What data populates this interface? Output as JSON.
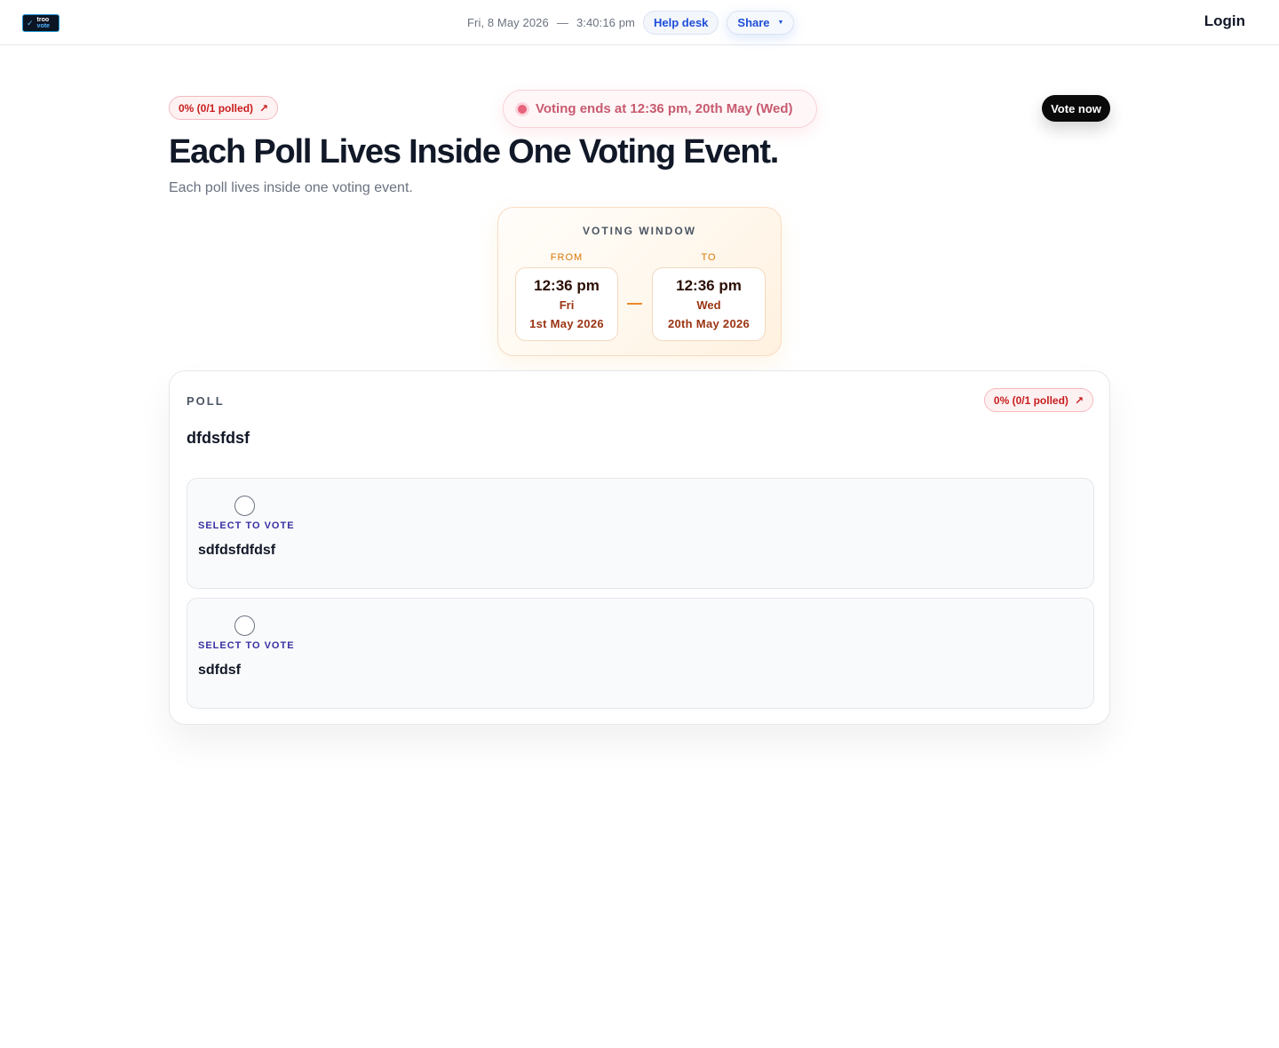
{
  "header": {
    "logo": {
      "line1": "troo",
      "line2": "vote"
    },
    "date": "Fri, 8 May 2026",
    "separator": "—",
    "time": "3:40:16 pm",
    "help_desk_label": "Help desk",
    "share_label": "Share",
    "login_label": "Login"
  },
  "event": {
    "polled_badge": "0% (0/1 polled)",
    "polled_fraction": 0,
    "ends_text": "Voting ends at 12:36 pm, 20th May (Wed)",
    "vote_now_label": "Vote now",
    "title": "Each Poll Lives Inside One Voting Event.",
    "subtitle": "Each poll lives inside one voting event."
  },
  "voting_window": {
    "title": "VOTING WINDOW",
    "from": {
      "label": "FROM",
      "time": "12:36 pm",
      "day": "Fri",
      "date": "1st May 2026"
    },
    "to": {
      "label": "TO",
      "time": "12:36 pm",
      "day": "Wed",
      "date": "20th May 2026"
    }
  },
  "poll": {
    "label": "POLL",
    "polled_badge": "0% (0/1 polled)",
    "question": "dfdsfdsf",
    "options": [
      {
        "select_label": "SELECT TO VOTE",
        "text": "sdfdsfdfdsf"
      },
      {
        "select_label": "SELECT TO VOTE",
        "text": "sdfdsf"
      }
    ]
  },
  "icons": {
    "logo_check": "check-icon",
    "polled_arrow": "arrow-up-right-icon",
    "share_caret": "caret-down-icon",
    "status_dot": "live-dot-icon",
    "option_radio": "radio-icon"
  },
  "colors": {
    "accent_blue": "#1d4ed8",
    "danger_red": "#c81e1e",
    "status_pink": "#c85a70",
    "window_orange": "#d97706",
    "select_indigo": "#3730a3"
  }
}
